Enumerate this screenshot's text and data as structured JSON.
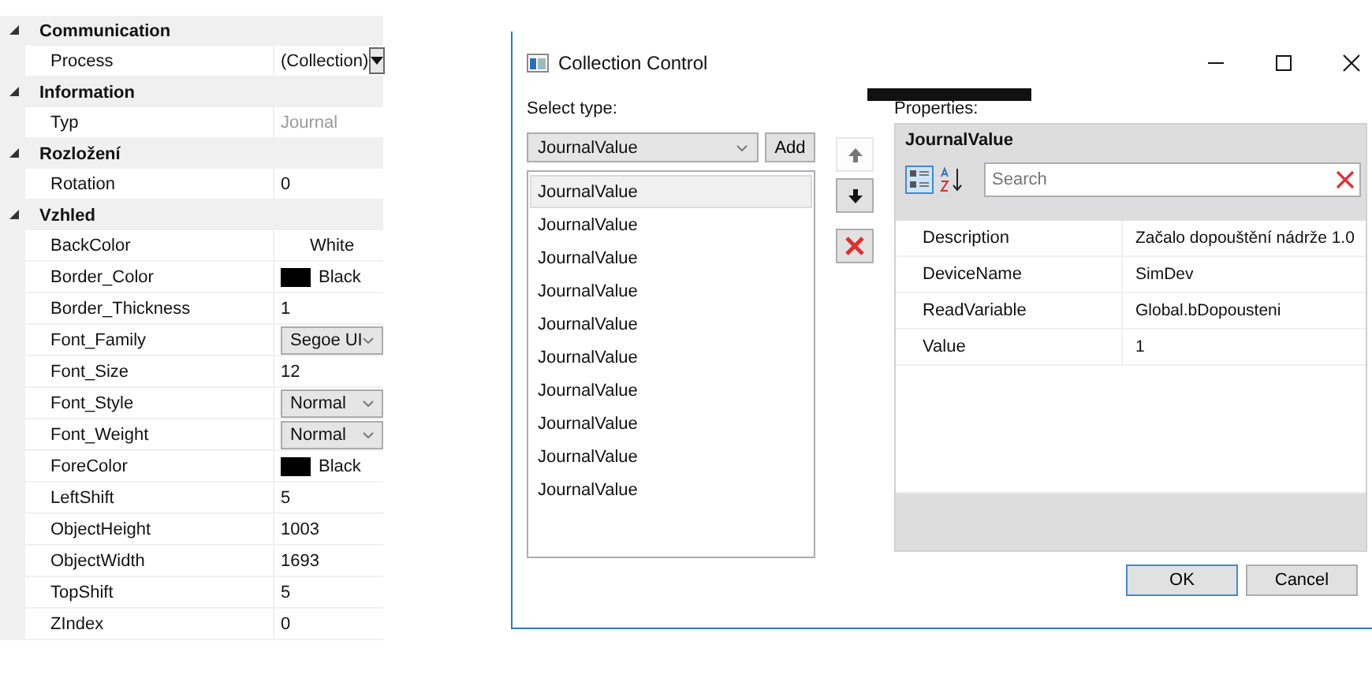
{
  "property_grid": {
    "categories": [
      {
        "name": "Communication",
        "expanded": true,
        "properties": [
          {
            "name": "Process",
            "value": "(Collection)",
            "kind": "collection"
          }
        ]
      },
      {
        "name": "Information",
        "expanded": true,
        "properties": [
          {
            "name": "Typ",
            "value": "Journal",
            "kind": "readonly"
          }
        ]
      },
      {
        "name": "Rozložení",
        "expanded": true,
        "properties": [
          {
            "name": "Rotation",
            "value": "0",
            "kind": "text"
          }
        ]
      },
      {
        "name": "Vzhled",
        "expanded": true,
        "properties": [
          {
            "name": "BackColor",
            "value": "White",
            "kind": "centered"
          },
          {
            "name": "Border_Color",
            "value": "Black",
            "kind": "color",
            "color": "#000000"
          },
          {
            "name": "Border_Thickness",
            "value": "1",
            "kind": "text"
          },
          {
            "name": "Font_Family",
            "value": "Segoe UI",
            "kind": "dropdown"
          },
          {
            "name": "Font_Size",
            "value": "12",
            "kind": "text"
          },
          {
            "name": "Font_Style",
            "value": "Normal",
            "kind": "dropdown"
          },
          {
            "name": "Font_Weight",
            "value": "Normal",
            "kind": "dropdown"
          },
          {
            "name": "ForeColor",
            "value": "Black",
            "kind": "color",
            "color": "#000000"
          },
          {
            "name": "LeftShift",
            "value": "5",
            "kind": "text"
          },
          {
            "name": "ObjectHeight",
            "value": "1003",
            "kind": "text"
          },
          {
            "name": "ObjectWidth",
            "value": "1693",
            "kind": "text"
          },
          {
            "name": "TopShift",
            "value": "5",
            "kind": "text"
          },
          {
            "name": "ZIndex",
            "value": "0",
            "kind": "text"
          }
        ]
      }
    ]
  },
  "dialog": {
    "title": "Collection Control",
    "select_type_label": "Select type:",
    "type_combo": "JournalValue",
    "add_button": "Add",
    "items": [
      {
        "label": "JournalValue",
        "selected": true
      },
      {
        "label": "JournalValue",
        "selected": false
      },
      {
        "label": "JournalValue",
        "selected": false
      },
      {
        "label": "JournalValue",
        "selected": false
      },
      {
        "label": "JournalValue",
        "selected": false
      },
      {
        "label": "JournalValue",
        "selected": false
      },
      {
        "label": "JournalValue",
        "selected": false
      },
      {
        "label": "JournalValue",
        "selected": false
      },
      {
        "label": "JournalValue",
        "selected": false
      },
      {
        "label": "JournalValue",
        "selected": false
      }
    ],
    "properties_label": "Properties:",
    "properties": {
      "header": "JournalValue",
      "search": {
        "placeholder": "Search"
      },
      "rows": [
        {
          "name": "Description",
          "value": "Začalo dopouštění nádrže 1.0"
        },
        {
          "name": "DeviceName",
          "value": "SimDev"
        },
        {
          "name": "ReadVariable",
          "value": "Global.bDopousteni"
        },
        {
          "name": "Value",
          "value": "1"
        }
      ]
    },
    "buttons": [
      {
        "label": "OK",
        "default": true
      },
      {
        "label": "Cancel",
        "default": false
      }
    ]
  }
}
